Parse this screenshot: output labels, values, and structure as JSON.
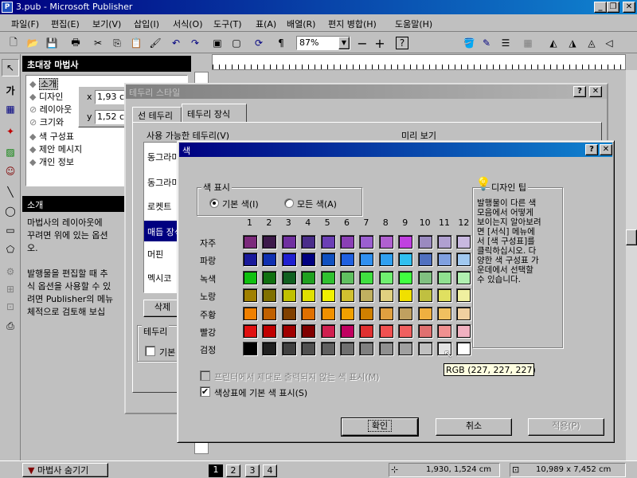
{
  "app": {
    "title": "3.pub - Microsoft Publisher"
  },
  "menu": [
    "파일(F)",
    "편집(E)",
    "보기(V)",
    "삽입(I)",
    "서식(O)",
    "도구(T)",
    "표(A)",
    "배열(R)",
    "편지 병합(H)",
    "도움말(H)"
  ],
  "toolbar": {
    "zoom": "87%",
    "zoom_minus": "−",
    "zoom_plus": "+"
  },
  "wizard": {
    "title": "초대장 마법사",
    "items": [
      "소개",
      "디자인",
      "레이아웃",
      "크기와",
      "색 구성표",
      "제안 메시지",
      "개인 정보"
    ],
    "x_label": "x",
    "x_value": "1,93 c",
    "y_label": "y",
    "y_value": "1,52 c",
    "section_title": "소개",
    "text_lines": [
      "마법사의 레이아웃에 ",
      "꾸려면 위에 있는 옵션",
      "오.",
      "",
      "발행물을 편집할 때 추",
      "식 옵션을 사용할 수 있",
      "려면 Publisher의 메뉴",
      "체적으로 검토해 보십"
    ],
    "hide_button": "마법사 숨기기"
  },
  "border_dialog": {
    "title": "테두리 스타일",
    "tabs": [
      "선 테두리",
      "테두리 장식"
    ],
    "available_label": "사용 가능한 테두리(V)",
    "preview_label": "미리 보기",
    "list": [
      "동그라미",
      "동그라미",
      "로켓트",
      "매듭 장식",
      "머핀",
      "멕시코"
    ],
    "delete_button": "삭제",
    "border_group": "테두리",
    "default_check": "기본"
  },
  "color_dialog": {
    "title": "색",
    "help_glyph": "?",
    "close_glyph": "✕",
    "display_group": "색 표시",
    "radio_basic": "기본 색(I)",
    "radio_all": "모든 색(A)",
    "columns": [
      "1",
      "2",
      "3",
      "4",
      "5",
      "6",
      "7",
      "8",
      "9",
      "10",
      "11",
      "12"
    ],
    "rows": [
      {
        "label": "자주",
        "colors": [
          "#7b2a7b",
          "#3d1a4b",
          "#7030a0",
          "#4a2d8a",
          "#6b3fb5",
          "#8a3fb5",
          "#9b5fd0",
          "#b060d0",
          "#c040e0",
          "#9a8ac0",
          "#b0a0d0",
          "#c8b8e0"
        ]
      },
      {
        "label": "파랑",
        "colors": [
          "#1a1a9a",
          "#1030b0",
          "#2020d0",
          "#000080",
          "#1050c0",
          "#2060e0",
          "#3090f0",
          "#30a0f0",
          "#30c0f0",
          "#5070c0",
          "#80a0e0",
          "#a0c8f0"
        ]
      },
      {
        "label": "녹색",
        "colors": [
          "#10c010",
          "#107010",
          "#106020",
          "#20a020",
          "#30c030",
          "#60c060",
          "#40e040",
          "#70f070",
          "#40ff40",
          "#80c080",
          "#90e090",
          "#b0f0b0"
        ]
      },
      {
        "label": "노랑",
        "colors": [
          "#a08000",
          "#807000",
          "#c0c000",
          "#e0e000",
          "#f0f000",
          "#d0c030",
          "#c0b060",
          "#e0d080",
          "#f0e000",
          "#c0c040",
          "#e0e060",
          "#f0f0a0"
        ]
      },
      {
        "label": "주황",
        "colors": [
          "#f08000",
          "#c06000",
          "#804000",
          "#e07000",
          "#f09000",
          "#f0a000",
          "#d08000",
          "#e0a040",
          "#c0a060",
          "#f0b040",
          "#f0c060",
          "#f0d0a0"
        ]
      },
      {
        "label": "빨강",
        "colors": [
          "#e01010",
          "#c00000",
          "#a00000",
          "#800000",
          "#d02050",
          "#c00060",
          "#e03030",
          "#f05050",
          "#f06060",
          "#e07070",
          "#f09090",
          "#f0b0c0"
        ]
      },
      {
        "label": "검정",
        "colors": [
          "#000000",
          "#202020",
          "#404040",
          "#505050",
          "#606060",
          "#707070",
          "#808080",
          "#909090",
          "#a0a0a0",
          "#c0c0c0",
          "#e3e3e3",
          "#ffffff"
        ]
      }
    ],
    "tooltip": "RGB (227, 227, 227)",
    "check_unprintable": "프린터에서 제대로 출력되지 않는 색 표시(M)",
    "check_show_basic": "색상표에 기본 색 표시(S)",
    "ok_button": "확인",
    "cancel_button": "취소",
    "apply_button": "적용(P)",
    "tip_title": "디자인 팁",
    "tip_lines": [
      "발행물이 다른 색",
      "모음에서 어떻게",
      "보이는지 알아보려",
      "면 [서식] 메뉴에",
      "서 [색 구성표]를",
      "클릭하십시오. 다",
      "양한 색 구성표 가",
      "운데에서 선택할",
      "수 있습니다."
    ]
  },
  "status": {
    "pages": [
      "1",
      "2",
      "3",
      "4"
    ],
    "position": "1,930, 1,524 cm",
    "size": "10,989 x  7,452 cm"
  }
}
